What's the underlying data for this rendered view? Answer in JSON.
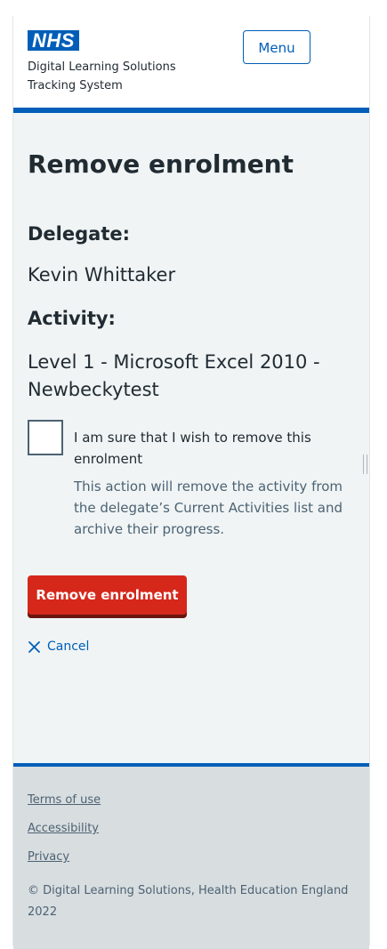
{
  "header": {
    "logo_text": "NHS",
    "brand_line1": "Digital Learning Solutions",
    "brand_line2": "Tracking System",
    "menu_label": "Menu"
  },
  "main": {
    "title": "Remove enrolment",
    "delegate_label": "Delegate:",
    "delegate_name": "Kevin Whittaker",
    "activity_label": "Activity:",
    "activity_name": "Level 1 - Microsoft Excel 2010 - Newbeckytest",
    "confirm": {
      "checked": false,
      "label": "I am sure that I wish to remove this enrolment",
      "hint": "This action will remove the activity from the delegate’s Current Activities list and archive their progress."
    },
    "remove_button": "Remove enrolment",
    "cancel_link": "Cancel"
  },
  "footer": {
    "links": [
      "Terms of use",
      "Accessibility",
      "Privacy"
    ],
    "copyright": "© Digital Learning Solutions, Health Education England 2022"
  },
  "icons": {
    "cancel": "close-icon",
    "logo": "nhs-logo"
  },
  "colors": {
    "brand_blue": "#005eb8",
    "danger_red": "#d5281b",
    "page_bg": "#f0f4f5",
    "footer_bg": "#d8dde0"
  }
}
